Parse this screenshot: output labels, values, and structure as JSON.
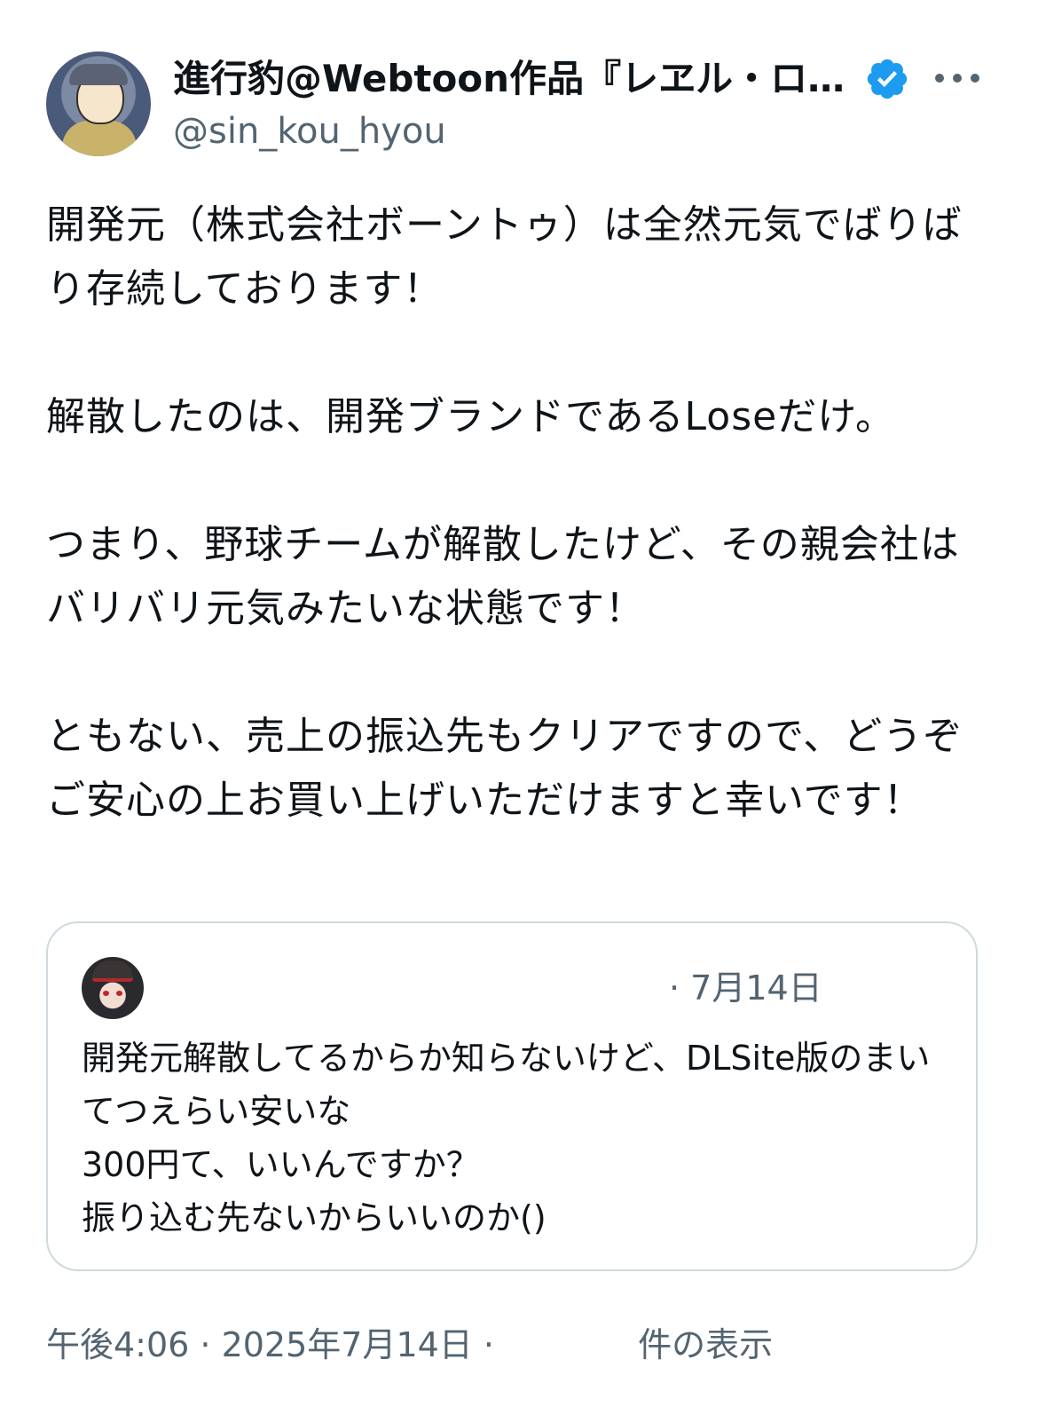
{
  "author": {
    "display_name": "進行豹@Webtoon作品『レヱル・ロ...",
    "handle": "@sin_kou_hyou",
    "verified": true
  },
  "tweet": {
    "text": "開発元（株式会社ボーントゥ）は全然元気でばりばり存続しております！\n\n解散したのは、開発ブランドであるLoseだけ。\n\nつまり、野球チームが解散したけど、その親会社はバリバリ元気みたいな状態です！\n\nともない、売上の振込先もクリアですので、どうぞご安心の上お買い上げいただけますと幸いです！"
  },
  "quote": {
    "date": "· 7月14日",
    "text": "開発元解散してるからか知らないけど、DLSite版のまいてつえらい安いな\n300円て、いいんですか？\n振り込む先ないからいいのか()"
  },
  "meta": {
    "timestamp": "午後4:06 · 2025年7月14日 ·",
    "views": "件の表示"
  },
  "colors": {
    "text": "#0f1419",
    "secondary": "#536471",
    "verified_blue": "#1d9bf0",
    "border": "#cfd9de"
  },
  "icons": {
    "verified": "verified-badge-icon",
    "more": "more-dots-icon"
  }
}
